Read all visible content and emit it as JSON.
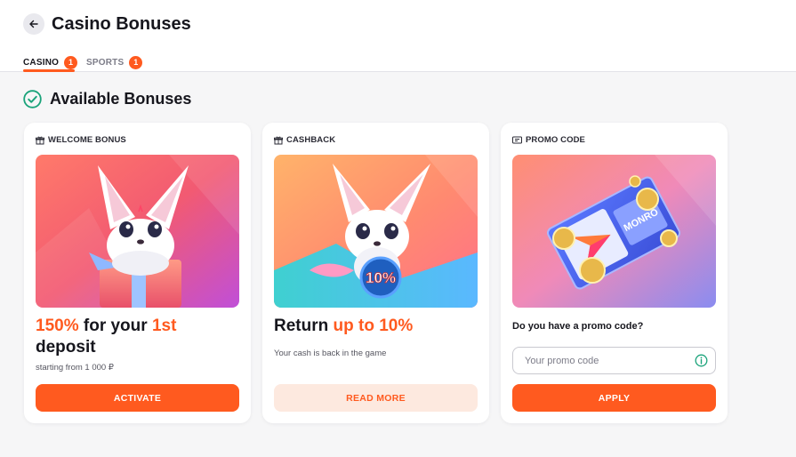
{
  "header": {
    "title": "Casino Bonuses",
    "back_icon": "arrow-left-icon"
  },
  "tabs": [
    {
      "label": "CASINO",
      "count": "1",
      "active": true
    },
    {
      "label": "SPORTS",
      "count": "1",
      "active": false
    }
  ],
  "section": {
    "title": "Available Bonuses",
    "icon": "check-circle-icon"
  },
  "colors": {
    "accent": "#ff5a1f",
    "accent_soft": "#fde9df",
    "success": "#1aa37a"
  },
  "cards": [
    {
      "label": "WELCOME BONUS",
      "icon": "gift-icon",
      "image": "fox-with-gift-box",
      "headline": {
        "p1": "150%",
        "p2": " for your ",
        "p3": "1st",
        "p4": " deposit"
      },
      "subtext": "starting from 1 000 ₽",
      "button": "ACTIVATE"
    },
    {
      "label": "CASHBACK",
      "icon": "gift-icon",
      "image": "fox-with-10-percent-badge",
      "image_badge": "10%",
      "headline": {
        "p1": "Return ",
        "p2": "up to 10%"
      },
      "subtext": "Your cash is back in the game",
      "button": "READ MORE"
    },
    {
      "label": "PROMO CODE",
      "icon": "ticket-icon",
      "image": "promo-ticket-with-coins",
      "image_text": "MONRO",
      "question": "Do you have a promo code?",
      "input_placeholder": "Your promo code",
      "input_value": "",
      "input_icon": "info-icon",
      "button": "APPLY"
    }
  ]
}
